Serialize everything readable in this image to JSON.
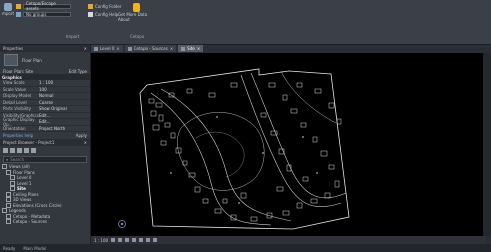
{
  "ribbon": {
    "import_label": "Import",
    "import_short": "mport",
    "dropdown1": "Cetopo/Escape assets",
    "dropdown2": "No groups",
    "config_folder": "Config Folder",
    "config_help": "Config Help",
    "get_more_data": "Get More Data About",
    "group_import": "Import",
    "group_cetopo": "Cetopo"
  },
  "properties": {
    "title": "Properties",
    "type_name": "Floor Plan",
    "selector": "Floor Plan: Site",
    "edit_type": "Edit Type",
    "section_graphics": "Graphics",
    "rows": [
      {
        "k": "View Scale",
        "v": "1 : 100"
      },
      {
        "k": "Scale Value",
        "v": "100"
      },
      {
        "k": "Display Model",
        "v": "Normal"
      },
      {
        "k": "Detail Level",
        "v": "Coarse"
      },
      {
        "k": "Parts Visibility",
        "v": "Show Original"
      },
      {
        "k": "Visibility/Graphics",
        "v": "Edit..."
      },
      {
        "k": "Graphic Display Op...",
        "v": "Edit..."
      },
      {
        "k": "Orientation",
        "v": "Project North"
      }
    ],
    "help_link": "Properties help",
    "apply_label": "Apply"
  },
  "browser": {
    "title": "Project Browser - Project1",
    "search_placeholder": "Search",
    "items": [
      "Views (all)",
      "Floor Plans",
      "Level 0",
      "Level 1",
      "Site",
      "Ceiling Plans",
      "3D Views",
      "Elevations (Cross Circle)",
      "Legends",
      "Cetopo - Metadata",
      "Cetopo - Sources"
    ]
  },
  "tabs": [
    "Level 0",
    "Cetopo - Sources",
    "Site"
  ],
  "viewbar": {
    "scale": "1 : 100"
  },
  "status": {
    "left": "Ready",
    "model": "Main Model"
  },
  "colors": {
    "ribbon_bg": "#3b4048",
    "canvas_bg": "#000000",
    "accent": "#f0b323"
  }
}
